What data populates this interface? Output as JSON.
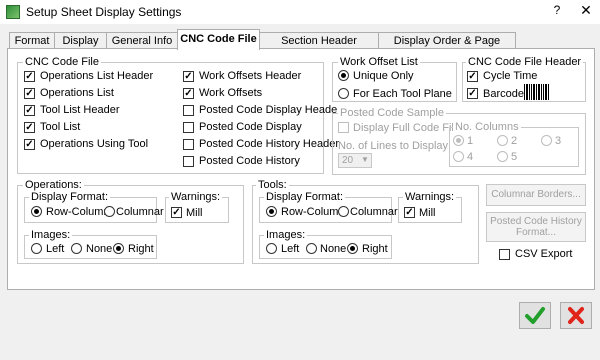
{
  "window": {
    "title": "Setup Sheet Display Settings",
    "help": "?",
    "close": "✕"
  },
  "tabs": [
    "Format",
    "Display",
    "General Info",
    "CNC Code File",
    "Section Header Captions",
    "Display Order & Page Breaks"
  ],
  "active_tab": "CNC Code File",
  "cnc_code_file": {
    "label": "CNC Code File",
    "left_items": [
      {
        "label": "Operations List Header",
        "checked": true
      },
      {
        "label": "Operations List",
        "checked": true
      },
      {
        "label": "Tool List Header",
        "checked": true
      },
      {
        "label": "Tool List",
        "checked": true
      },
      {
        "label": "Operations Using Tool",
        "checked": true
      }
    ],
    "right_items": [
      {
        "label": "Work Offsets Header",
        "checked": true
      },
      {
        "label": "Work Offsets",
        "checked": true
      },
      {
        "label": "Posted Code Display Header",
        "checked": false
      },
      {
        "label": "Posted Code Display",
        "checked": false
      },
      {
        "label": "Posted Code History Header",
        "checked": false
      },
      {
        "label": "Posted Code History",
        "checked": false
      }
    ]
  },
  "work_offset_list": {
    "label": "Work Offset List",
    "options": [
      "Unique Only",
      "For Each Tool Plane"
    ],
    "selected": "Unique Only"
  },
  "cnc_code_file_header": {
    "label": "CNC Code File Header",
    "cycle_time": "Cycle Time",
    "barcode": "Barcode",
    "barcode_icon": "barcode-icon"
  },
  "posted_code_sample": {
    "label": "Posted Code Sample",
    "display_full": "Display Full Code File",
    "lines_label": "No. of Lines to Display",
    "lines_value": "20",
    "columns_label": "No. Columns",
    "columns": [
      "1",
      "2",
      "3",
      "4",
      "5"
    ],
    "columns_selected": "1"
  },
  "operations": {
    "label": "Operations:",
    "display_format_label": "Display Format:",
    "display_format_options": [
      "Row-Column",
      "Columnar"
    ],
    "display_format_selected": "Row-Column",
    "warnings_label": "Warnings:",
    "mill": "Mill",
    "images_label": "Images:",
    "images_options": [
      "Left",
      "None",
      "Right"
    ],
    "images_selected": "Right"
  },
  "tools": {
    "label": "Tools:",
    "display_format_label": "Display Format:",
    "display_format_options": [
      "Row-Column",
      "Columnar"
    ],
    "display_format_selected": "Row-Column",
    "warnings_label": "Warnings:",
    "mill": "Mill",
    "images_label": "Images:",
    "images_options": [
      "Left",
      "None",
      "Right"
    ],
    "images_selected": "Right"
  },
  "side_buttons": {
    "columnar_borders": "Columnar Borders...",
    "posted_history_1": "Posted Code History",
    "posted_history_2": "Format..."
  },
  "csv_export": "CSV Export",
  "footer": {
    "ok_icon": "checkmark-icon",
    "cancel_icon": "x-icon",
    "ok_color": "#22a02b",
    "cancel_color": "#e0241a"
  }
}
